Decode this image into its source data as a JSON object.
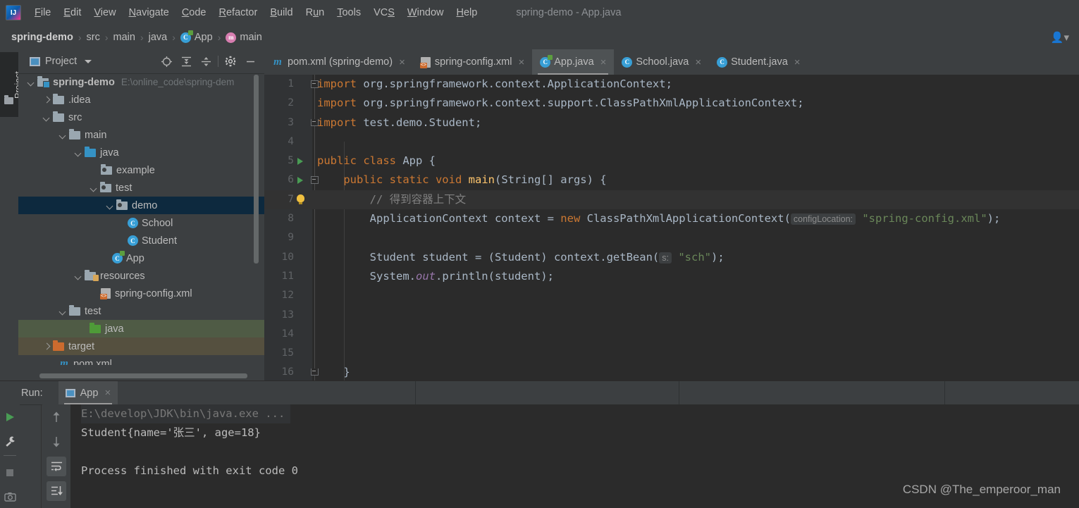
{
  "window": {
    "title": "spring-demo - App.java",
    "logo_icon": "intellij-idea-logo"
  },
  "menubar": {
    "items": [
      {
        "label": "File"
      },
      {
        "label": "Edit"
      },
      {
        "label": "View"
      },
      {
        "label": "Navigate"
      },
      {
        "label": "Code"
      },
      {
        "label": "Refactor"
      },
      {
        "label": "Build"
      },
      {
        "label": "Run"
      },
      {
        "label": "Tools"
      },
      {
        "label": "VCS"
      },
      {
        "label": "Window"
      },
      {
        "label": "Help"
      }
    ]
  },
  "breadcrumb": {
    "items": [
      {
        "label": "spring-demo",
        "icon": "none"
      },
      {
        "label": "src",
        "icon": "none"
      },
      {
        "label": "main",
        "icon": "none"
      },
      {
        "label": "java",
        "icon": "none"
      },
      {
        "label": "App",
        "icon": "class-icon"
      },
      {
        "label": "main",
        "icon": "method-icon"
      }
    ],
    "separator": "›",
    "account_icon": "user-accounts-icon"
  },
  "left_strip": {
    "project_tab": "Project",
    "structure_icon": "folder-icon"
  },
  "project_panel": {
    "title": "Project",
    "title_icon": "project-view-icon",
    "caret_icon": "chevron-down-icon",
    "toolbar": [
      {
        "name": "locate-icon"
      },
      {
        "name": "expand-all-icon"
      },
      {
        "name": "collapse-all-icon"
      },
      {
        "name": "gear-icon"
      },
      {
        "name": "minimize-icon"
      }
    ],
    "tree": [
      {
        "label": "spring-demo",
        "path": "E:\\online_code\\spring-dem",
        "indent": 0,
        "arrow": "down",
        "icon": "module-folder",
        "bold": true,
        "state": "normal"
      },
      {
        "label": ".idea",
        "indent": 1,
        "arrow": "right",
        "icon": "folder-gray",
        "state": "normal"
      },
      {
        "label": "src",
        "indent": 1,
        "arrow": "down",
        "icon": "folder-gray",
        "state": "normal"
      },
      {
        "label": "main",
        "indent": 2,
        "arrow": "down",
        "icon": "folder-gray",
        "state": "normal"
      },
      {
        "label": "java",
        "indent": 3,
        "arrow": "down",
        "icon": "folder-blue",
        "state": "normal"
      },
      {
        "label": "example",
        "indent": 4,
        "arrow": "none",
        "icon": "package-icon",
        "state": "normal"
      },
      {
        "label": "test",
        "indent": 4,
        "arrow": "down",
        "icon": "package-icon",
        "state": "normal"
      },
      {
        "label": "demo",
        "indent": 5,
        "arrow": "down",
        "icon": "package-icon",
        "state": "selected"
      },
      {
        "label": "School",
        "indent": 6,
        "arrow": "none",
        "icon": "class-icon",
        "state": "normal"
      },
      {
        "label": "Student",
        "indent": 6,
        "arrow": "none",
        "icon": "class-icon",
        "state": "normal"
      },
      {
        "label": "App",
        "indent": 5,
        "arrow": "none",
        "icon": "runnable-class-icon",
        "state": "normal"
      },
      {
        "label": "resources",
        "indent": 3,
        "arrow": "down",
        "icon": "resources-folder",
        "state": "normal"
      },
      {
        "label": "spring-config.xml",
        "indent": 4,
        "arrow": "none",
        "icon": "xml-file-icon",
        "state": "normal"
      },
      {
        "label": "test",
        "indent": 2,
        "arrow": "down",
        "icon": "folder-gray",
        "state": "normal"
      },
      {
        "label": "java",
        "indent": 3,
        "arrow": "none",
        "icon": "folder-green",
        "state": "test-source"
      },
      {
        "label": "target",
        "indent": 1,
        "arrow": "right",
        "icon": "folder-orange",
        "state": "excluded"
      },
      {
        "label": "pom.xml",
        "indent": 2,
        "arrow": "none",
        "icon": "maven-file-icon",
        "state": "normal"
      }
    ]
  },
  "editor": {
    "tabs": [
      {
        "label": "pom.xml (spring-demo)",
        "icon": "maven-file-icon",
        "active": false,
        "close": "×"
      },
      {
        "label": "spring-config.xml",
        "icon": "xml-file-icon",
        "active": false,
        "close": "×"
      },
      {
        "label": "App.java",
        "icon": "runnable-class-icon",
        "active": true,
        "close": "×"
      },
      {
        "label": "School.java",
        "icon": "class-icon",
        "active": false,
        "close": "×"
      },
      {
        "label": "Student.java",
        "icon": "class-icon",
        "active": false,
        "close": "×"
      }
    ],
    "lines": [
      {
        "n": "1",
        "gutter": "fold-collapsed",
        "segments": [
          {
            "t": "import",
            "c": "kw"
          },
          {
            "t": " org.springframework.context.ApplicationContext;",
            "c": ""
          }
        ]
      },
      {
        "n": "2",
        "gutter": "",
        "segments": [
          {
            "t": "import",
            "c": "kw"
          },
          {
            "t": " org.springframework.context.support.ClassPathXmlApplicationContext;",
            "c": ""
          }
        ]
      },
      {
        "n": "3",
        "gutter": "fold-end",
        "segments": [
          {
            "t": "import",
            "c": "kw"
          },
          {
            "t": " test.demo.Student;",
            "c": ""
          }
        ]
      },
      {
        "n": "4",
        "gutter": "",
        "segments": []
      },
      {
        "n": "5",
        "gutter": "run-marker",
        "segments": [
          {
            "t": "public class",
            "c": "kw"
          },
          {
            "t": " App {",
            "c": ""
          }
        ]
      },
      {
        "n": "6",
        "gutter": "run-marker-fold",
        "segments": [
          {
            "t": "    ",
            "c": ""
          },
          {
            "t": "public static void",
            "c": "kw"
          },
          {
            "t": " ",
            "c": ""
          },
          {
            "t": "main",
            "c": "fn"
          },
          {
            "t": "(String[] args) {",
            "c": ""
          }
        ]
      },
      {
        "n": "7",
        "gutter": "bulb",
        "current": true,
        "segments": [
          {
            "t": "        // 得到容器上下文",
            "c": "cmt"
          }
        ]
      },
      {
        "n": "8",
        "gutter": "",
        "segments": [
          {
            "t": "        ApplicationContext context = ",
            "c": ""
          },
          {
            "t": "new",
            "c": "kw"
          },
          {
            "t": " ClassPathXmlApplicationContext(",
            "c": ""
          },
          {
            "t": "configLocation:",
            "c": "hint"
          },
          {
            "t": " ",
            "c": ""
          },
          {
            "t": "\"spring-config.xml\"",
            "c": "str"
          },
          {
            "t": ");",
            "c": ""
          }
        ]
      },
      {
        "n": "9",
        "gutter": "",
        "segments": []
      },
      {
        "n": "10",
        "gutter": "",
        "segments": [
          {
            "t": "        Student student = (Student) context.getBean(",
            "c": ""
          },
          {
            "t": "s:",
            "c": "hint"
          },
          {
            "t": " ",
            "c": ""
          },
          {
            "t": "\"sch\"",
            "c": "str"
          },
          {
            "t": ");",
            "c": ""
          }
        ]
      },
      {
        "n": "11",
        "gutter": "",
        "segments": [
          {
            "t": "        System.",
            "c": ""
          },
          {
            "t": "out",
            "c": "fld"
          },
          {
            "t": ".println(student);",
            "c": ""
          }
        ]
      },
      {
        "n": "12",
        "gutter": "",
        "segments": []
      },
      {
        "n": "13",
        "gutter": "",
        "segments": []
      },
      {
        "n": "14",
        "gutter": "",
        "segments": []
      },
      {
        "n": "15",
        "gutter": "",
        "segments": []
      },
      {
        "n": "16",
        "gutter": "fold-end",
        "segments": [
          {
            "t": "    }",
            "c": ""
          }
        ]
      }
    ]
  },
  "run_panel": {
    "label": "Run:",
    "tab_label": "App",
    "tab_icon": "run-configuration-icon",
    "tab_close": "×",
    "left_buttons": [
      {
        "name": "rerun-icon"
      },
      {
        "name": "wrench-settings-icon"
      },
      {
        "name": "stop-icon"
      },
      {
        "name": "screenshot-icon"
      }
    ],
    "right_buttons": [
      {
        "name": "up-arrow-icon"
      },
      {
        "name": "down-arrow-icon"
      },
      {
        "name": "soft-wrap-icon"
      },
      {
        "name": "scroll-to-end-icon"
      }
    ],
    "console": [
      {
        "text": "E:\\develop\\JDK\\bin\\java.exe ...",
        "style": "dim"
      },
      {
        "text": "Student{name='张三', age=18}",
        "style": "normal"
      },
      {
        "text": "",
        "style": "normal"
      },
      {
        "text": "Process finished with exit code 0",
        "style": "normal"
      }
    ]
  },
  "watermark": {
    "text": "CSDN @The_emperoor_man"
  },
  "colors": {
    "chrome_bg": "#3c3f41",
    "editor_bg": "#2b2b2b",
    "gutter_bg": "#313335",
    "selection_blue": "#0d293e",
    "test_source_green": "#4f5b45",
    "excluded_brown": "#55503f",
    "keyword_orange": "#cc7832",
    "string_green": "#6a8759",
    "text_gray": "#a9b7c6",
    "accent_blue": "#3592c4"
  }
}
